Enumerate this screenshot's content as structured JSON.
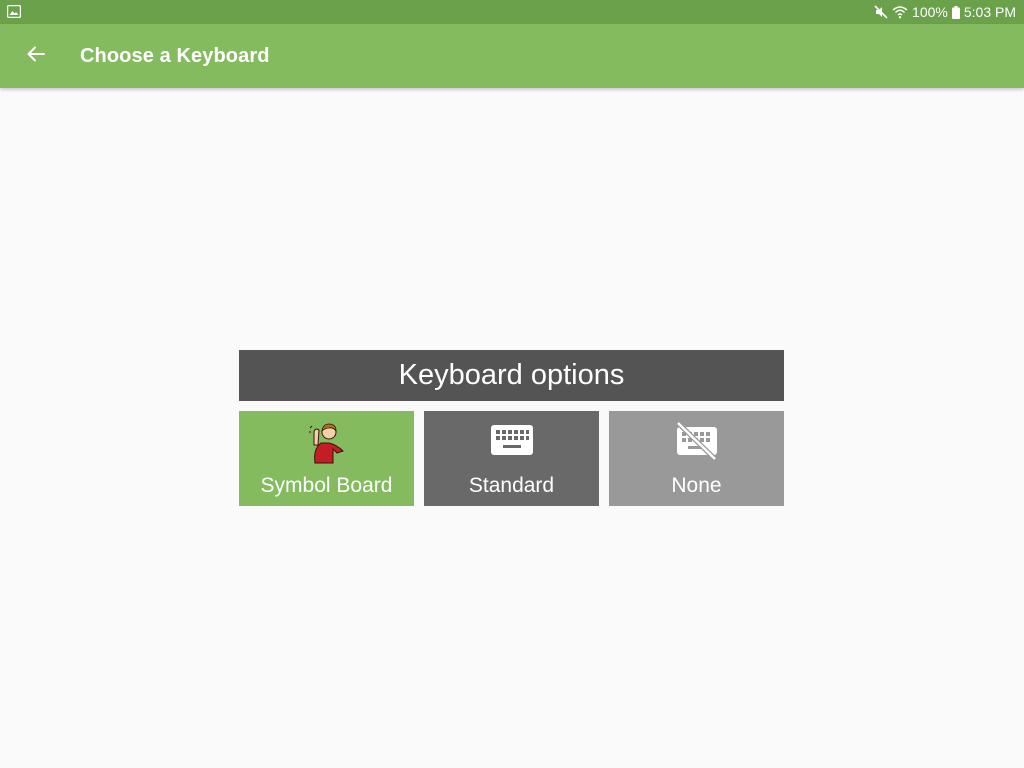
{
  "status_bar": {
    "left_icon": "image-icon",
    "mute_icon": "mute-icon",
    "wifi_icon": "wifi-icon",
    "battery_icon": "battery-icon",
    "battery_text": "100%",
    "time": "5:03 PM"
  },
  "app_bar": {
    "back_icon": "arrow-back-icon",
    "title": "Choose a Keyboard",
    "color": "#83bb5e"
  },
  "keyboard_panel": {
    "header": "Keyboard options",
    "options": [
      {
        "label": "Symbol Board",
        "icon": "symbol-person-icon",
        "color": "#83bb5e"
      },
      {
        "label": "Standard",
        "icon": "keyboard-icon",
        "color": "#696969"
      },
      {
        "label": "None",
        "icon": "keyboard-off-icon",
        "color": "#999999"
      }
    ]
  }
}
